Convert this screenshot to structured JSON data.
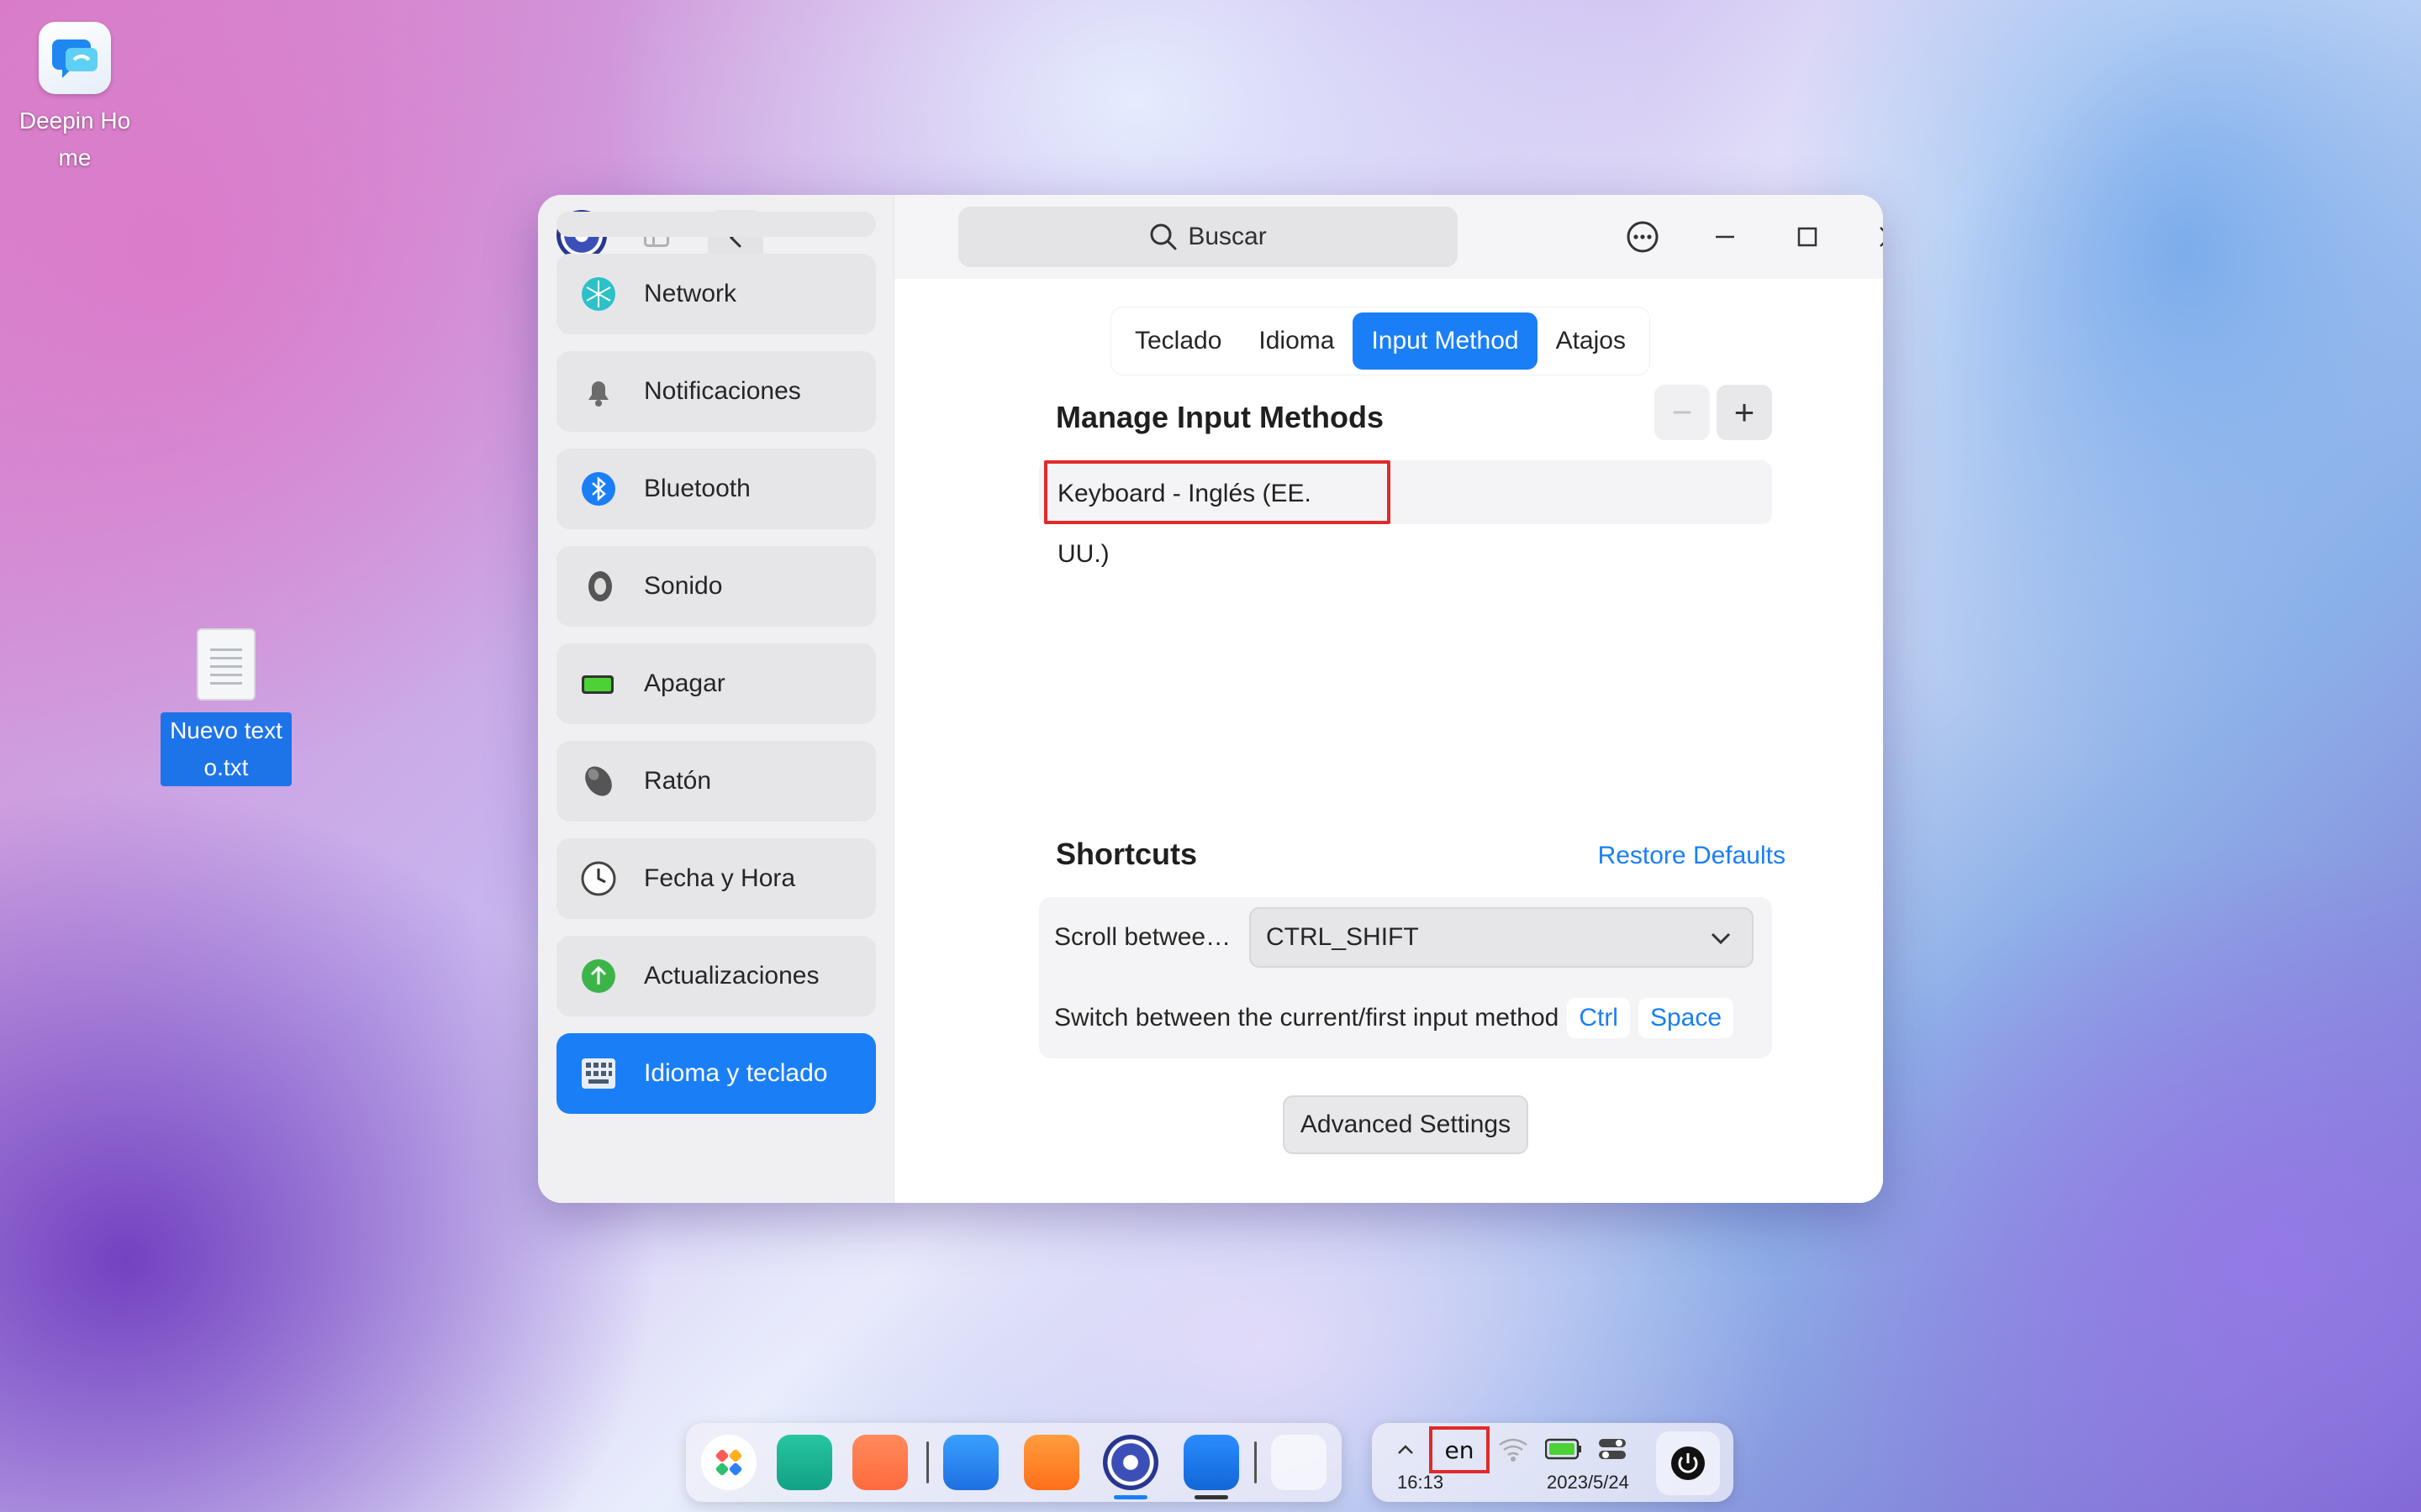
{
  "desktop": {
    "icons": [
      {
        "label": "Deepin Home"
      },
      {
        "label": "Nuevo texto.txt"
      }
    ]
  },
  "window": {
    "search_placeholder": "Buscar",
    "sidebar": {
      "items": [
        {
          "label": "Network",
          "icon": "network-icon"
        },
        {
          "label": "Notificaciones",
          "icon": "bell-icon"
        },
        {
          "label": "Bluetooth",
          "icon": "bluetooth-icon"
        },
        {
          "label": "Sonido",
          "icon": "speaker-icon"
        },
        {
          "label": "Apagar",
          "icon": "battery-icon"
        },
        {
          "label": "Ratón",
          "icon": "mouse-icon"
        },
        {
          "label": "Fecha y Hora",
          "icon": "clock-icon"
        },
        {
          "label": "Actualizaciones",
          "icon": "update-arrow-icon"
        },
        {
          "label": "Idioma y teclado",
          "icon": "keyboard-icon",
          "active": true
        }
      ]
    },
    "tabs": [
      {
        "label": "Teclado"
      },
      {
        "label": "Idioma"
      },
      {
        "label": "Input Method",
        "active": true
      },
      {
        "label": "Atajos"
      }
    ],
    "manage": {
      "title": "Manage Input Methods",
      "remove_label": "−",
      "add_label": "+",
      "items": [
        "Keyboard - Inglés (EE. UU.)"
      ]
    },
    "shortcuts": {
      "title": "Shortcuts",
      "restore_label": "Restore Defaults",
      "scroll_label": "Scroll betwee…",
      "scroll_value": "CTRL_SHIFT",
      "switch_label": "Switch between the current/first input method",
      "switch_keys": [
        "Ctrl",
        "Space"
      ]
    },
    "advanced_label": "Advanced Settings"
  },
  "taskbar": {
    "language_indicator": "en",
    "time": "16:13",
    "date": "2023/5/24"
  },
  "colors": {
    "accent": "#1a7ff6",
    "highlight_box": "#e02a2a"
  }
}
